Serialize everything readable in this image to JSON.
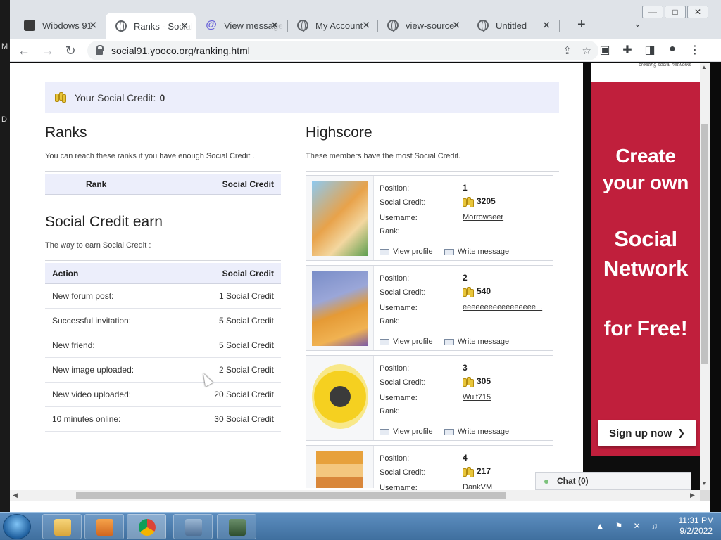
{
  "desktop": {
    "edge_labels": [
      "M",
      "D"
    ]
  },
  "browser": {
    "tabs": [
      {
        "title": "Wibdows 91",
        "icon": "app-icon"
      },
      {
        "title": "Ranks - Social",
        "icon": "globe-icon",
        "active": true
      },
      {
        "title": "View message",
        "icon": "at-icon"
      },
      {
        "title": "My Account",
        "icon": "globe-icon"
      },
      {
        "title": "view-source",
        "icon": "globe-icon"
      },
      {
        "title": "Untitled",
        "icon": "globe-icon"
      }
    ],
    "url": "social91.yooco.org/ranking.html",
    "window_controls": {
      "minimize": "—",
      "maximize": "□",
      "close": "✕"
    }
  },
  "page": {
    "credit_label": "Your Social Credit:",
    "credit_value": "0",
    "ranks": {
      "title": "Ranks",
      "subtitle": "You can reach these ranks if you have enough Social Credit .",
      "col_rank": "Rank",
      "col_credit": "Social Credit"
    },
    "earn": {
      "title": "Social Credit earn",
      "subtitle": "The way to earn Social Credit :",
      "col_action": "Action",
      "col_credit": "Social Credit",
      "rows": [
        {
          "action": "New forum post:",
          "credit": "1 Social Credit"
        },
        {
          "action": "Successful invitation:",
          "credit": "5 Social Credit"
        },
        {
          "action": "New friend:",
          "credit": "5 Social Credit"
        },
        {
          "action": "New image uploaded:",
          "credit": "2 Social Credit"
        },
        {
          "action": "New video uploaded:",
          "credit": "20 Social Credit"
        },
        {
          "action": "10 minutes online:",
          "credit": "30 Social Credit"
        }
      ]
    },
    "highscore": {
      "title": "Highscore",
      "subtitle": "These members have the most Social Credit.",
      "labels": {
        "position": "Position:",
        "credit": "Social Credit:",
        "username": "Username:",
        "rank": "Rank:"
      },
      "view_profile": "View profile",
      "write_message": "Write message",
      "members": [
        {
          "position": "1",
          "credit": "3205",
          "username": "Morrowseer",
          "rank": ""
        },
        {
          "position": "2",
          "credit": "540",
          "username": "eeeeeeeeeeeeeeeee...",
          "rank": ""
        },
        {
          "position": "3",
          "credit": "305",
          "username": "Wulf715",
          "rank": ""
        },
        {
          "position": "4",
          "credit": "217",
          "username": "DankVM",
          "rank": ""
        }
      ]
    },
    "ad": {
      "tagline": "creating social networks",
      "line1": "Create",
      "line2": "your own",
      "line3": "Social",
      "line4": "Network",
      "line5": "for Free!",
      "cta": "Sign up now",
      "cta_arrow": "❯"
    },
    "chat": "Chat (0)"
  },
  "taskbar": {
    "time": "11:31 PM",
    "date": "9/2/2022",
    "tray_icons": "▲ ⚑ ✕ ♫"
  },
  "colors": {
    "accent_band": "#eceefb",
    "ad_red": "#c01f3c",
    "coin": "#e8c53a"
  }
}
